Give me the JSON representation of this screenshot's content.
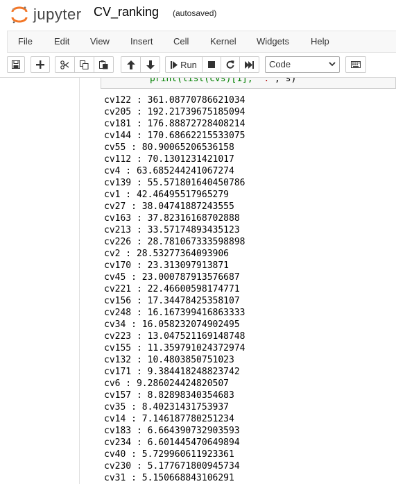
{
  "header": {
    "logo_text": "jupyter",
    "notebook_title": "CV_ranking",
    "save_status": "(autosaved)"
  },
  "menu": [
    "File",
    "Edit",
    "View",
    "Insert",
    "Cell",
    "Kernel",
    "Widgets",
    "Help"
  ],
  "toolbar": {
    "run_label": "Run",
    "cell_type": "Code",
    "icons": [
      "save-icon",
      "plus-icon",
      "cut-icon",
      "copy-icon",
      "paste-icon",
      "arrow-up-icon",
      "arrow-down-icon",
      "step-forward-icon",
      "stop-icon",
      "restart-icon",
      "fast-forward-icon",
      "chevron-down-icon",
      "keyboard-icon"
    ]
  },
  "cell": {
    "code_prefix": "print(list(cvs)[1], ",
    "code_string": "':'",
    "code_suffix": ", s)",
    "output_lines": [
      "cv122 : 361.08770786621034",
      "cv205 : 192.21739675185094",
      "cv181 : 176.88872728408214",
      "cv144 : 170.68662215533075",
      "cv55 : 80.90065206536158",
      "cv112 : 70.1301231421017",
      "cv4 : 63.685244241067274",
      "cv139 : 55.571801640450786",
      "cv1 : 42.46495517965279",
      "cv27 : 38.04741887243555",
      "cv163 : 37.82316168702888",
      "cv213 : 33.57174893435123",
      "cv226 : 28.781067333598898",
      "cv2 : 28.53277364093906",
      "cv170 : 23.313097913871",
      "cv45 : 23.000787913576687",
      "cv221 : 22.46600598174771",
      "cv156 : 17.34478425358107",
      "cv248 : 16.167399416863333",
      "cv34 : 16.058232074902495",
      "cv223 : 13.047521169148748",
      "cv155 : 11.359791024372974",
      "cv132 : 10.4803850751023",
      "cv171 : 9.384418248823742",
      "cv6 : 9.286024424820507",
      "cv157 : 8.82898340354683",
      "cv35 : 8.40231431753937",
      "cv14 : 7.146187780251234",
      "cv183 : 6.664390732903593",
      "cv234 : 6.601445470649894",
      "cv40 : 5.729960611923361",
      "cv230 : 5.177671800945734",
      "cv31 : 5.150668843106291"
    ]
  },
  "colors": {
    "jupyter_orange": "#f37626",
    "code_keyword": "#008000",
    "code_string": "#ba2121"
  }
}
